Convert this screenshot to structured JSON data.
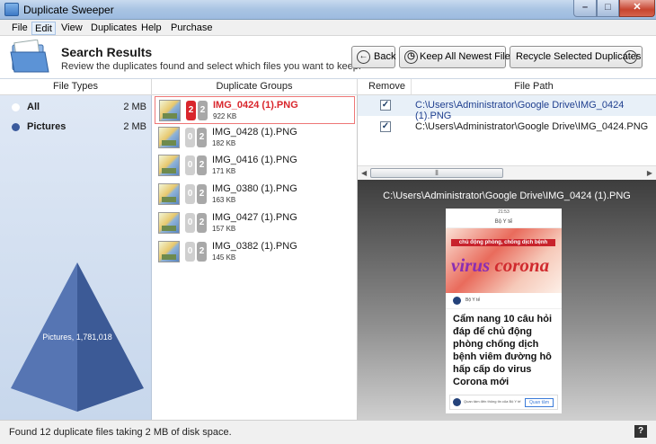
{
  "window": {
    "title": "Duplicate Sweeper"
  },
  "menu": [
    "File",
    "Edit",
    "View",
    "Duplicates",
    "Help",
    "Purchase"
  ],
  "header": {
    "title": "Search Results",
    "subtitle": "Review the duplicates found and select which files you want to keep.",
    "back_label": "Back",
    "keep_newest_label": "Keep All Newest Files",
    "recycle_label": "Recycle Selected Duplicates"
  },
  "file_types": {
    "header": "File Types",
    "items": [
      {
        "name": "All",
        "size": "2 MB"
      },
      {
        "name": "Pictures",
        "size": "2 MB"
      }
    ],
    "chart_label": "Pictures, 1,781,018"
  },
  "groups": {
    "header": "Duplicate Groups",
    "items": [
      {
        "name": "IMG_0424 (1).PNG",
        "size": "922 KB",
        "selected_count": "2",
        "total_count": "2"
      },
      {
        "name": "IMG_0428 (1).PNG",
        "size": "182 KB",
        "selected_count": "0",
        "total_count": "2"
      },
      {
        "name": "IMG_0416 (1).PNG",
        "size": "171 KB",
        "selected_count": "0",
        "total_count": "2"
      },
      {
        "name": "IMG_0380 (1).PNG",
        "size": "163 KB",
        "selected_count": "0",
        "total_count": "2"
      },
      {
        "name": "IMG_0427 (1).PNG",
        "size": "157 KB",
        "selected_count": "0",
        "total_count": "2"
      },
      {
        "name": "IMG_0382 (1).PNG",
        "size": "145 KB",
        "selected_count": "0",
        "total_count": "2"
      }
    ]
  },
  "files": {
    "remove_header": "Remove",
    "path_header": "File Path",
    "rows": [
      {
        "checked": "✓",
        "path": "C:\\Users\\Administrator\\Google Drive\\IMG_0424 (1).PNG"
      },
      {
        "checked": "✓",
        "path": "C:\\Users\\Administrator\\Google Drive\\IMG_0424.PNG"
      }
    ]
  },
  "preview": {
    "path": "C:\\Users\\Administrator\\Google Drive\\IMG_0424 (1).PNG",
    "status_time": "21:53",
    "nav_title": "Bộ Y tế",
    "banner_top": "chủ động phòng, chống dịch bệnh",
    "banner_word1": "virus",
    "banner_word2": "corona",
    "source": "Bộ Y tế",
    "headline": "Cẩm nang 10 câu hỏi đáp để chủ động phòng chống dịch bệnh viêm đường hô hấp cấp do virus Corona mới",
    "ad_text": "Quan tâm đến thông tin của Bộ Y tế",
    "ad_button": "Quan tâm"
  },
  "status": {
    "text": "Found 12 duplicate files taking 2 MB of disk space.",
    "help": "?"
  },
  "colors": {
    "selected_red": "#d9262c",
    "dot_blue": "#3a5a9c",
    "pyramid": "#4a6aa8"
  }
}
